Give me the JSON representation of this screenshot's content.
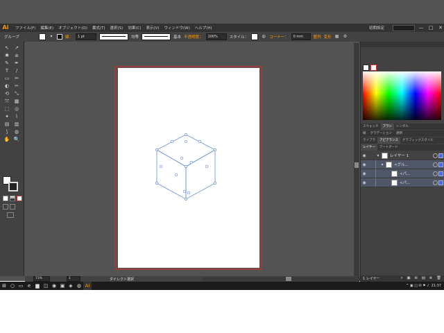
{
  "menubar": {
    "logo": "Ai",
    "items": [
      "ファイル(F)",
      "編集(E)",
      "オブジェクト(O)",
      "書式(T)",
      "選択(S)",
      "効果(C)",
      "表示(V)",
      "ウィンドウ(W)",
      "ヘルプ(H)"
    ],
    "workspace": "初期設定",
    "window_buttons": [
      "—",
      "□",
      "✕"
    ]
  },
  "controlbar": {
    "selection": "グループ",
    "stroke_label": "線：",
    "stroke_weight": "1 pt",
    "profile_label": "均等",
    "brush_label": "基本",
    "opacity_label": "不透明度：",
    "opacity_value": "100%",
    "style_label": "スタイル：",
    "corner_label": "コーナー：",
    "corner_value": "0 mm",
    "align_label": "整列",
    "transform_label": "変形"
  },
  "toolbar": {
    "tools": [
      "↖",
      "↗",
      "✱",
      "ɷ",
      "✎",
      "✒",
      "T",
      "/",
      "▭",
      "✏",
      "◐",
      "✂",
      "⟲",
      "⤡",
      "⤧",
      "▦",
      "⬚",
      "◎",
      "✦",
      "⌇",
      "▤",
      "▥",
      "⟆",
      "◍",
      "✋",
      "🔍"
    ]
  },
  "canvas": {
    "accent": "#9c3b3b",
    "path_color": "#6b8fd6"
  },
  "statusbar": {
    "zoom": "73%",
    "page": "1",
    "tool_name": "ダイレクト選択"
  },
  "panels": {
    "color_tabs": [
      "スウォッチ",
      "ブラシ",
      "シンボル"
    ],
    "gradient_tabs": [
      "線",
      "グラデーション",
      "透明"
    ],
    "appearance_tabs": [
      "ライブラ",
      "アピアランス",
      "グラフィックスタイル"
    ],
    "layer_tabs": [
      "レイヤー",
      "アートボード"
    ],
    "layers": [
      {
        "name": "レイヤー 1",
        "level": 0
      },
      {
        "name": "<グル...",
        "level": 1
      },
      {
        "name": "<パ...",
        "level": 2
      },
      {
        "name": "<パ...",
        "level": 2
      }
    ],
    "footer_text": "1 レイヤー"
  },
  "taskbar": {
    "time": "21:37",
    "apps": [
      "⊞",
      "○",
      "▭",
      "e",
      "▆",
      "◫",
      "◉",
      "▣",
      "◈",
      "◍",
      "Ai"
    ]
  }
}
